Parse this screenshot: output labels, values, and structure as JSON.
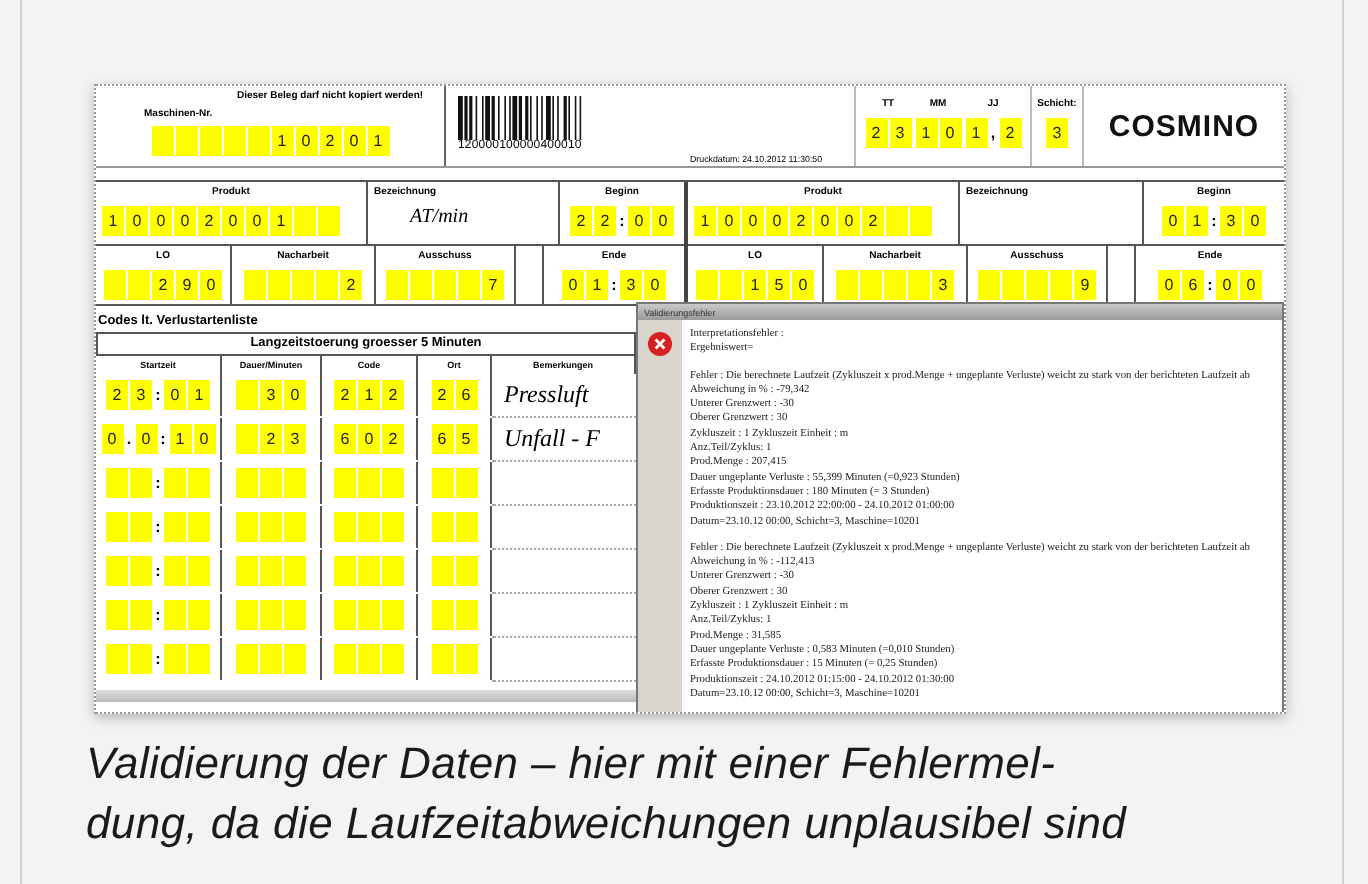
{
  "form": {
    "notice": "Dieser Beleg darf nicht kopiert werden!",
    "machine": {
      "label": "Maschinen-Nr.",
      "value": "1 0 2 0 1"
    },
    "barcode_number": "120000100000400010",
    "print_date": "Druckdatum: 24.10.2012 11:30:50",
    "date_fields": [
      {
        "label": "TT",
        "value": "2 3"
      },
      {
        "label": "MM",
        "value": "1 0"
      },
      {
        "label": "JJ",
        "value": "1 , 2"
      }
    ],
    "shift": {
      "label": "Schicht:",
      "value": "3"
    },
    "logo": "COSMINO",
    "orders": [
      {
        "product": {
          "label": "Produkt",
          "value": "1 0 0 0 2 0 0 1"
        },
        "designation": {
          "label": "Bezeichnung",
          "value": "AT/min"
        },
        "start": {
          "label": "Beginn",
          "value": "2 2 : 0 0"
        },
        "lo": {
          "label": "LO",
          "value": "2 9 0"
        },
        "rework": {
          "label": "Nacharbeit",
          "value": "2"
        },
        "scrap": {
          "label": "Ausschuss",
          "value": "7"
        },
        "end": {
          "label": "Ende",
          "value": "0 1 : 3 0"
        }
      },
      {
        "product": {
          "label": "Produkt",
          "value": "1 0 0 0 2 0 0 2"
        },
        "designation": {
          "label": "Bezeichnung"
        },
        "start": {
          "label": "Beginn",
          "value": "0 1 : 3 0"
        },
        "lo": {
          "label": "LO",
          "value": "1 5 0"
        },
        "rework": {
          "label": "Nacharbeit",
          "value": "3"
        },
        "scrap": {
          "label": "Ausschuss",
          "value": "9"
        },
        "end": {
          "label": "Ende",
          "value": "0 6 : 0 0"
        }
      }
    ]
  },
  "downtime": {
    "title": "Codes lt. Verlustartenliste",
    "heading": "Langzeitstoerung groesser 5 Minuten",
    "columns": [
      "Startzeit",
      "Dauer/Minuten",
      "Code",
      "Ort",
      "Bemerkungen"
    ],
    "rows": [
      {
        "start": "2 3 : 0 1",
        "duration": "3 0",
        "code": "2 1 2",
        "place": "2 6",
        "remark": "Pressluft"
      },
      {
        "start": "0 . 0 : 1 0",
        "duration": "2 3",
        "code": "6 0 2",
        "place": "6 5",
        "remark": "Unfall - F"
      },
      {
        "start": ":"
      },
      {
        "start": ":"
      },
      {
        "start": ":"
      },
      {
        "start": ":"
      },
      {
        "start": ":"
      }
    ]
  },
  "dialog": {
    "title": "Validierungsfehler",
    "blocks": [
      {
        "lines": [
          "Interpretationsfehler :",
          "Ergebniswert="
        ]
      },
      {
        "lines": [
          "Fehler : Die berechnete Laufzeit (Zykluszeit x prod.Menge + ungeplante Verluste) weicht zu stark von der berichteten Laufzeit ab",
          "Abweichung in % : -79,342",
          "Unterer Grenzwert : -30",
          "Oberer Grenzwert : 30",
          "Zykluszeit : 1 Zykluszeit Einheit : m",
          "Anz.Teil/Zyklus: 1",
          "Prod.Menge : 207,415",
          "Dauer ungeplante Verluste : 55,399 Minuten (=0,923 Stunden)",
          "Erfasste Produktionsdauer : 180 Minuten (= 3 Stunden)",
          "Produktionszeit : 23.10.2012 22:00:00 - 24.10.2012 01:00:00",
          "Datum=23.10.12 00:00, Schicht=3, Maschine=10201"
        ]
      },
      {
        "lines": [
          "Fehler : Die berechnete Laufzeit (Zykluszeit x prod.Menge + ungeplante Verluste) weicht zu stark von der berichteten Laufzeit ab",
          "Abweichung in % : -112,413",
          "Unterer Grenzwert : -30",
          "Oberer Grenzwert : 30",
          "Zykluszeit : 1 Zykluszeit Einheit : m",
          "Anz.Teil/Zyklus: 1",
          "Prod.Menge : 31,585",
          "Dauer ungeplante Verluste : 0,583 Minuten (=0,010 Stunden)",
          "Erfasste Produktionsdauer : 15 Minuten (= 0,25 Stunden)",
          "Produktionszeit : 24.10.2012 01:15:00 - 24.10.2012 01:30:00",
          "Datum=23.10.12 00:00, Schicht=3, Maschine=10201"
        ]
      }
    ]
  },
  "caption": "Validierung der Daten – hier mit einer Fehlermel-\ndung, da die Laufzeitabweichungen unplausibel sind"
}
